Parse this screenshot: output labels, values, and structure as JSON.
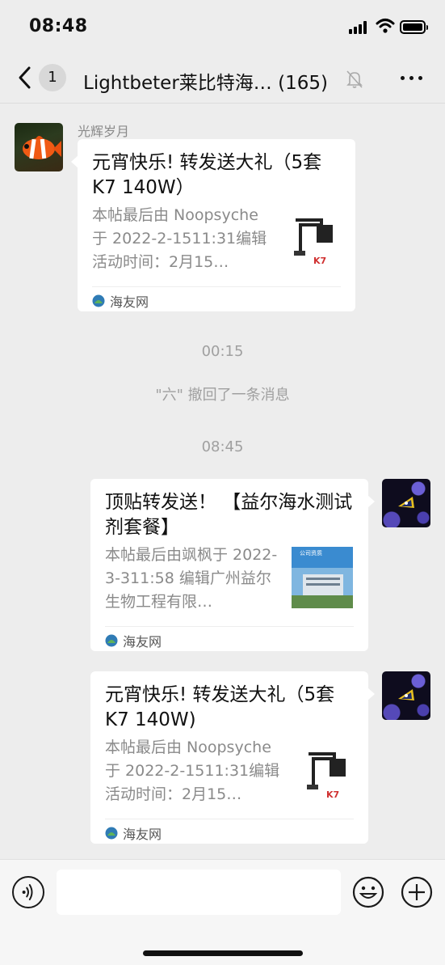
{
  "status_bar": {
    "time": "08:48"
  },
  "nav": {
    "unread_count": "1",
    "title": "Lightbeter莱比特海…",
    "member_count": "(165)"
  },
  "messages": [
    {
      "sender": "光辉岁月",
      "title": "元宵快乐! 转发送大礼（5套 K7  140W）",
      "desc": "本帖最后由 Noopsyche 于 2022-2-1511:31编辑活动时间：2月15…",
      "source": "海友网",
      "thumb_caption": "K7"
    },
    {
      "title": "顶贴转发送！ 【益尔海水测试剂套餐】",
      "desc": "本帖最后由飒枫于 2022-3-311:58 编辑广州益尔生物工程有限…",
      "source": "海友网",
      "thumb_caption": "公司资质"
    },
    {
      "title": "元宵快乐! 转发送大礼（5套 K7  140W)",
      "desc": "本帖最后由 Noopsyche 于 2022-2-1511:31编辑活动时间：2月15…",
      "source": "海友网",
      "thumb_caption": "K7"
    }
  ],
  "timestamps": {
    "t1": "00:15",
    "t2": "08:45"
  },
  "system_message": "\"六\" 撤回了一条消息",
  "input": {
    "placeholder": ""
  },
  "colors": {
    "background": "#ededed",
    "card": "#ffffff",
    "muted_text": "#8a8a8a"
  }
}
